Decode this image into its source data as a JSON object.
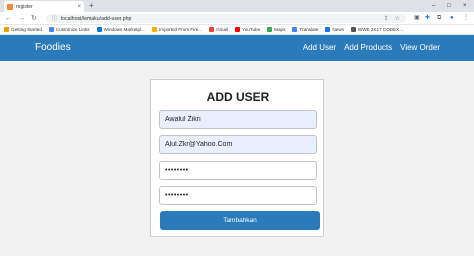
{
  "browser": {
    "tab_title": "register",
    "tab_close": "×",
    "new_tab": "+",
    "window_controls": [
      "–",
      "□",
      "×"
    ],
    "nav_back": "←",
    "nav_forward": "→",
    "nav_reload": "↻",
    "url": "localhost/lemaku/add-user.php",
    "bookmarks": [
      {
        "label": "Getting Started",
        "color": "#f29900"
      },
      {
        "label": "Customize Links",
        "color": "#4285f4"
      },
      {
        "label": "Windows Marketpl...",
        "color": "#0078d7"
      },
      {
        "label": "Imported From Fire...",
        "color": "#f9ab00"
      },
      {
        "label": "Gmail",
        "color": "#ea4335"
      },
      {
        "label": "YouTube",
        "color": "#ff0000"
      },
      {
        "label": "Maps",
        "color": "#34a853"
      },
      {
        "label": "Translate",
        "color": "#4285f4"
      },
      {
        "label": "News",
        "color": "#1a73e8"
      },
      {
        "label": "WWE 2K17 CODEX...",
        "color": "#555555"
      }
    ]
  },
  "navbar": {
    "brand": "Foodies",
    "links": [
      "Add User",
      "Add Products",
      "View Order"
    ],
    "color": "#2b7bbb"
  },
  "form": {
    "title": "ADD USER",
    "name_value": "Awalul Zikri",
    "email_value": "Alul.Zkr@Yahoo.Com",
    "password_value": "••••••••",
    "confirm_password_value": "••••••••",
    "submit_label": "Tambahkan"
  }
}
